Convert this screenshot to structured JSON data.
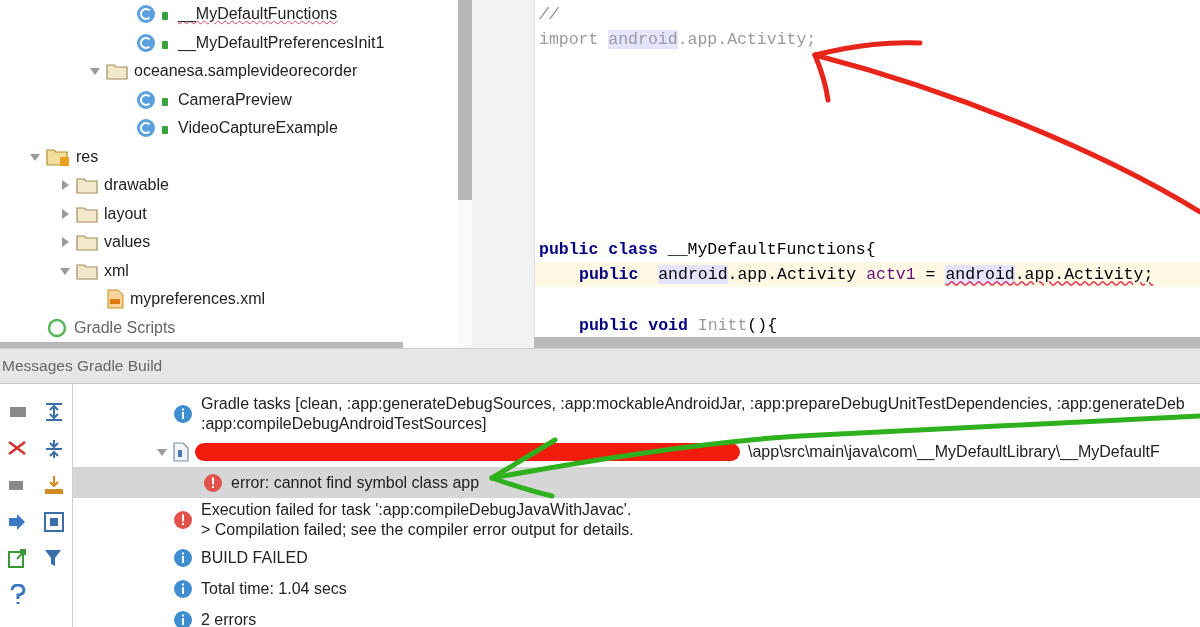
{
  "project_tree": [
    {
      "children": [
        {
          "children": [
            {
              "children": [
                {
                  "label": "__MyDefaultFunctions",
                  "kind": "class",
                  "error": true
                },
                {
                  "label": "__MyDefaultPreferencesInit1",
                  "kind": "class",
                  "error": false
                }
              ]
            },
            {
              "label": "oceanesa.samplevideorecorder",
              "kind": "package",
              "expanded": true,
              "children": [
                {
                  "label": "CameraPreview",
                  "kind": "class",
                  "error": false
                },
                {
                  "label": "VideoCaptureExample",
                  "kind": "class",
                  "error": false
                }
              ]
            }
          ]
        }
      ]
    },
    {
      "label": "res",
      "kind": "res-folder",
      "expanded": true,
      "children": [
        {
          "label": "drawable",
          "kind": "folder",
          "expanded": false
        },
        {
          "label": "layout",
          "kind": "folder",
          "expanded": false
        },
        {
          "label": "values",
          "kind": "folder",
          "expanded": false
        },
        {
          "label": "xml",
          "kind": "folder",
          "expanded": true,
          "children": [
            {
              "label": "mypreferences.xml",
              "kind": "xml",
              "error": false
            }
          ]
        }
      ]
    },
    {
      "label": "Gradle Scripts",
      "kind": "gradle"
    }
  ],
  "editor": {
    "sections": [
      {
        "lines": [
          {
            "tokens": [
              {
                "text": "//",
                "kind": "comment"
              }
            ]
          },
          {
            "tokens": [
              {
                "text": "import ",
                "kind": "unused"
              },
              {
                "text": "android",
                "kind": "unused-ref"
              },
              {
                "text": ".app.Activity;",
                "kind": "unused"
              }
            ]
          }
        ]
      },
      {
        "lines": [
          {
            "tokens": [
              {
                "text": "public class",
                "kind": "keyword"
              },
              {
                "text": " __MyDefaultFunctions{",
                "kind": "plain"
              }
            ]
          },
          {
            "current": true,
            "indented": true,
            "tokens": [
              {
                "text": "public  ",
                "kind": "keyword"
              },
              {
                "text": "android",
                "kind": "ref"
              },
              {
                "text": ".app.Activity ",
                "kind": "plain"
              },
              {
                "text": "actv1",
                "kind": "field"
              },
              {
                "text": " = ",
                "kind": "plain"
              },
              {
                "text": "android",
                "kind": "error-ref"
              },
              {
                "text": ".app.Activity;",
                "kind": "error"
              }
            ]
          }
        ]
      },
      {
        "lines": [
          {
            "indented": true,
            "tokens": [
              {
                "text": "public void ",
                "kind": "keyword"
              },
              {
                "text": "Initt",
                "kind": "unused"
              },
              {
                "text": "(){",
                "kind": "plain"
              }
            ]
          }
        ]
      }
    ]
  },
  "messages_panel": {
    "tabs": "Messages Gradle Build",
    "messages": [
      {
        "kind": "info",
        "selected": false,
        "lines": [
          "Gradle tasks [clean, :app:generateDebugSources, :app:mockableAndroidJar, :app:prepareDebugUnitTestDependencies, :app:generateDeb",
          ":app:compileDebugAndroidTestSources]"
        ]
      },
      {
        "kind": "file",
        "selected": false,
        "expanded": true,
        "redacted": true,
        "lines": [
          "\\app\\src\\main\\java\\com\\__MyDefaultLibrary\\__MyDefaultF"
        ],
        "children": [
          {
            "kind": "error",
            "selected": true,
            "lines": [
              "error: cannot find symbol class app"
            ]
          }
        ]
      },
      {
        "kind": "error",
        "selected": false,
        "lines": [
          "Execution failed for task ':app:compileDebugJavaWithJavac'.",
          "> Compilation failed; see the compiler error output for details."
        ]
      },
      {
        "kind": "info",
        "selected": false,
        "lines": [
          "BUILD FAILED"
        ]
      },
      {
        "kind": "info",
        "selected": false,
        "lines": [
          "Total time: 1.04 secs"
        ]
      },
      {
        "kind": "info",
        "selected": false,
        "lines": [
          "2 errors"
        ]
      }
    ]
  }
}
